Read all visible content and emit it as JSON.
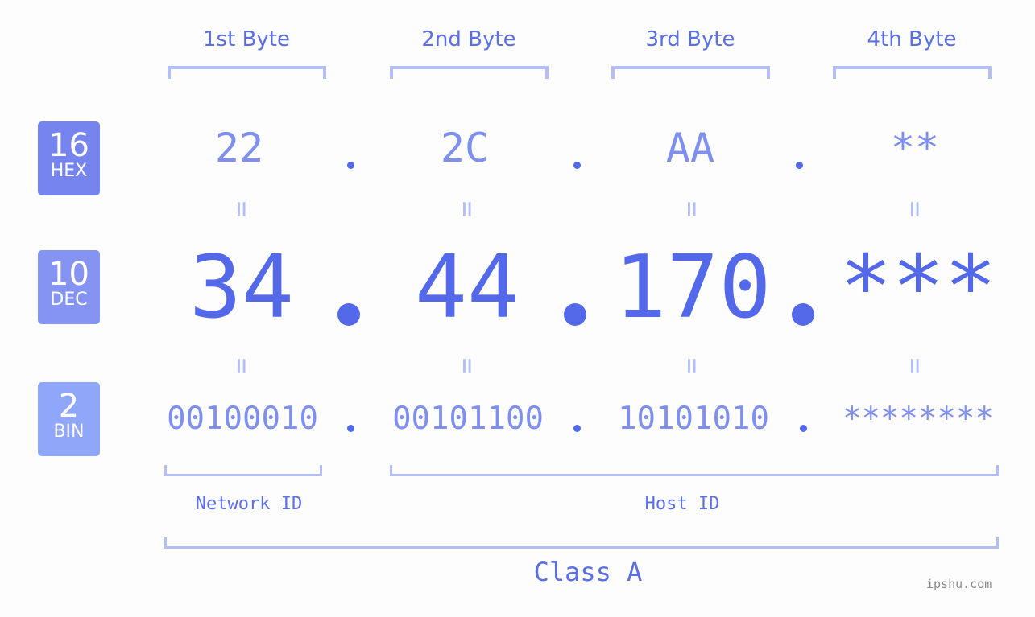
{
  "byte_headers": [
    "1st Byte",
    "2nd Byte",
    "3rd Byte",
    "4th Byte"
  ],
  "badges": [
    {
      "num": "16",
      "label": "HEX",
      "color": "#7584ee"
    },
    {
      "num": "10",
      "label": "DEC",
      "color": "#8594f2"
    },
    {
      "num": "2",
      "label": "BIN",
      "color": "#8fa6f9"
    }
  ],
  "hex": [
    "22",
    "2C",
    "AA",
    "**"
  ],
  "dec": [
    "34",
    "44",
    "170",
    "***"
  ],
  "bin": [
    "00100010",
    "00101100",
    "10101010",
    "********"
  ],
  "equals": "=",
  "segments": {
    "network": "Network ID",
    "host": "Host ID"
  },
  "class_label": "Class A",
  "watermark": "ipshu.com",
  "colors": {
    "accent": "#5468ea",
    "light": "#7f8ff0",
    "bracket": "#b3bdf8"
  }
}
